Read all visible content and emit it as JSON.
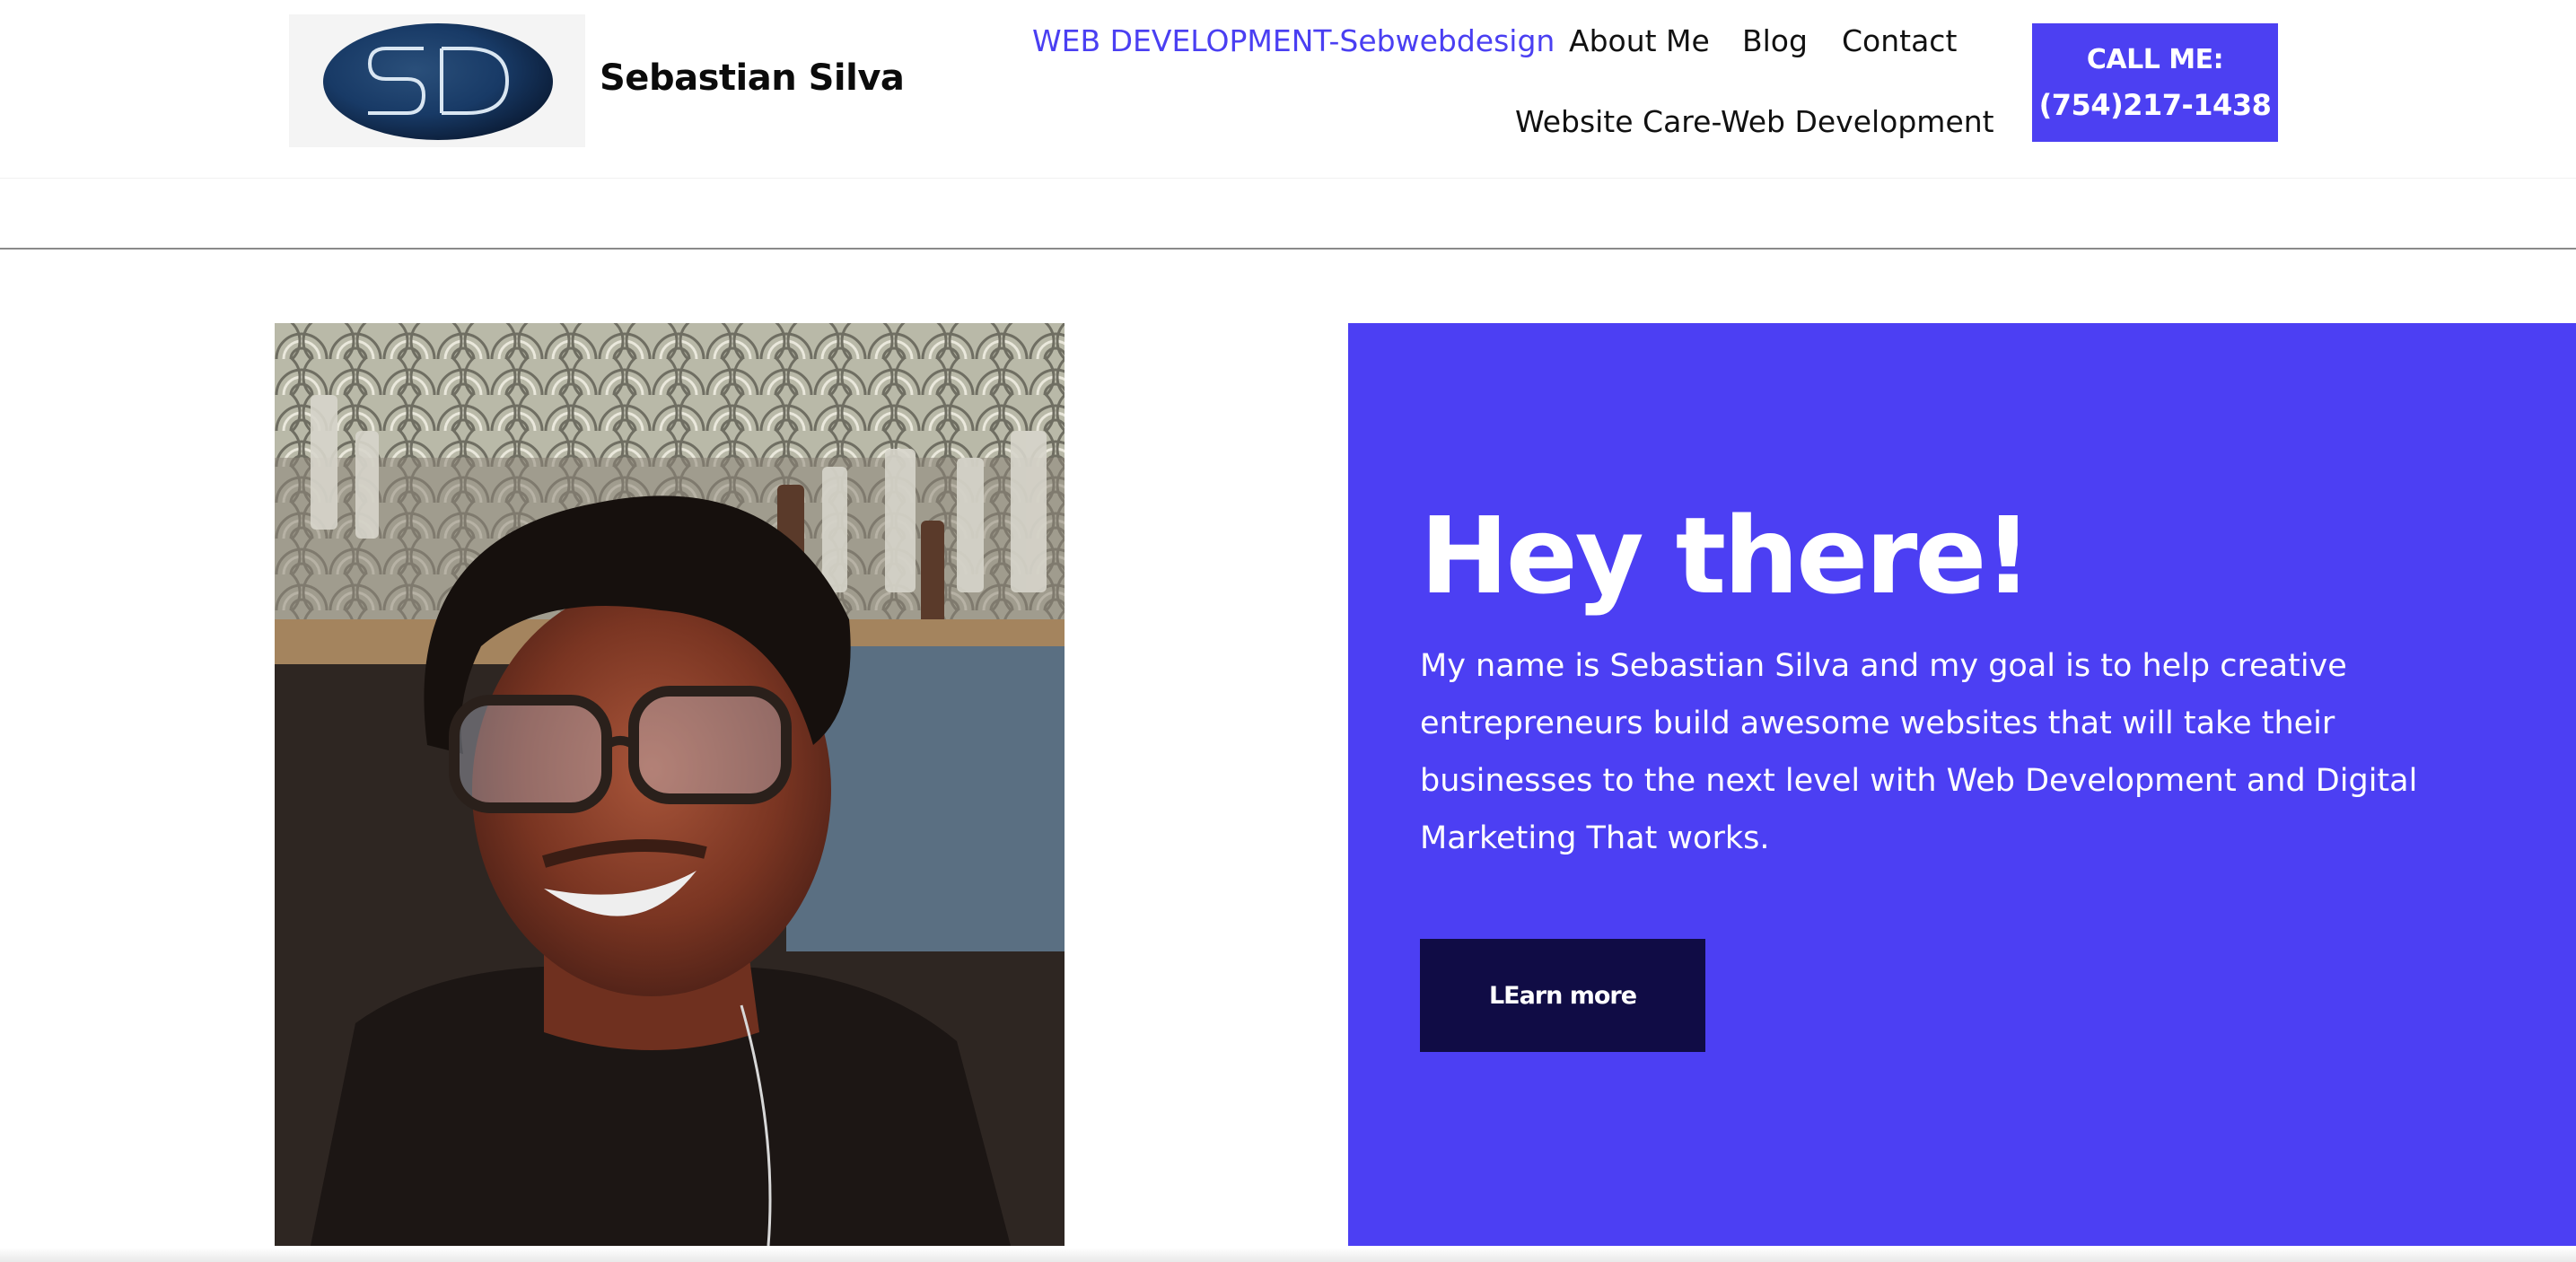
{
  "header": {
    "logo_text": "SD",
    "brand_name": "Sebastian Silva",
    "nav": [
      {
        "label": "WEB DEVELOPMENT-Sebwebdesign",
        "active": true
      },
      {
        "label": "About Me"
      },
      {
        "label": "Blog"
      },
      {
        "label": "Contact"
      },
      {
        "label": "Website Care-Web Development"
      }
    ],
    "cta": {
      "line1": "CALL ME:",
      "line2": "(754)217-1438"
    }
  },
  "hero": {
    "title": "Hey there!",
    "body": "My name is Sebastian Silva and my goal is to help creative entrepreneurs build awesome websites that will take their businesses to the next level with Web Development and Digital Marketing That works.",
    "button_label": "LEarn more"
  },
  "colors": {
    "accent": "#4c3ff3",
    "button_dark": "#100c45",
    "nav_active": "#4a3ff2"
  }
}
